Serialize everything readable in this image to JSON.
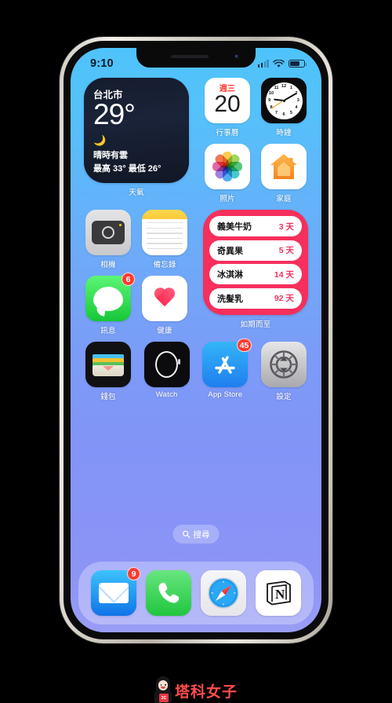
{
  "device": {
    "frame_color": "#d8d3cb",
    "wallpaper_top": "#4fc3fb",
    "wallpaper_bottom": "#9a9df5"
  },
  "status_bar": {
    "time": "9:10",
    "cellular_icon": "signal-bars-icon",
    "wifi_icon": "wifi-icon",
    "battery_icon": "battery-icon"
  },
  "widgets": {
    "weather": {
      "city": "台北市",
      "temperature": "29°",
      "condition_icon": "moon-cloud-icon",
      "condition": "晴時有雲",
      "range": "最高 33° 最低 26°",
      "label": "天氣"
    },
    "calendar": {
      "weekday": "週三",
      "day": "20",
      "label": "行事曆"
    },
    "clock": {
      "label": "時鐘",
      "numerals": [
        "12",
        "1",
        "2",
        "3",
        "4",
        "5",
        "6",
        "7",
        "8",
        "9",
        "10",
        "11"
      ],
      "hour_deg": 277,
      "minute_deg": 60,
      "second_deg": 237
    },
    "expiry": {
      "label": "如期而至",
      "accent": "#f62f5c",
      "items": [
        {
          "name": "義美牛奶",
          "days": "3 天"
        },
        {
          "name": "奇異果",
          "days": "5 天"
        },
        {
          "name": "冰淇淋",
          "days": "14 天"
        },
        {
          "name": "洗髮乳",
          "days": "92 天"
        }
      ]
    }
  },
  "apps": {
    "photos": {
      "label": "照片",
      "icon": "photos-icon"
    },
    "home": {
      "label": "家庭",
      "icon": "home-house-icon"
    },
    "camera": {
      "label": "相機",
      "icon": "camera-icon"
    },
    "notes": {
      "label": "備忘錄",
      "icon": "notes-icon"
    },
    "messages": {
      "label": "訊息",
      "icon": "messages-bubble-icon",
      "badge": "6"
    },
    "health": {
      "label": "健康",
      "icon": "heart-icon"
    },
    "wallet": {
      "label": "錢包",
      "icon": "wallet-icon"
    },
    "watch": {
      "label": "Watch",
      "icon": "watch-icon"
    },
    "appstore": {
      "label": "App Store",
      "icon": "app-store-icon",
      "badge": "45"
    },
    "settings": {
      "label": "設定",
      "icon": "gear-icon"
    }
  },
  "search": {
    "label": "搜尋",
    "icon": "search-icon"
  },
  "dock": {
    "mail": {
      "label": "Mail",
      "icon": "mail-envelope-icon",
      "badge": "9"
    },
    "phone": {
      "label": "Phone",
      "icon": "phone-handset-icon"
    },
    "safari": {
      "label": "Safari",
      "icon": "safari-compass-icon"
    },
    "notion": {
      "label": "Notion",
      "icon": "notion-n-icon"
    }
  },
  "watermark": {
    "text": "塔科女子",
    "mug_text": "3C",
    "color": "#ff4d4d"
  }
}
